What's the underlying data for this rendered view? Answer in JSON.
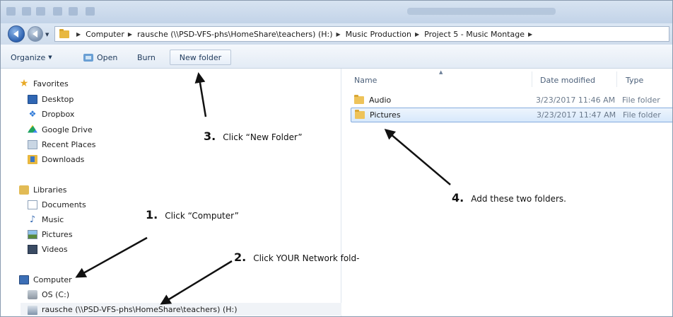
{
  "address_bar": {
    "breadcrumbs": [
      "Computer",
      "rausche (\\\\PSD-VFS-phs\\HomeShare\\teachers) (H:)",
      "Music Production",
      "Project 5 - Music Montage"
    ]
  },
  "toolbar": {
    "organize_label": "Organize",
    "open_label": "Open",
    "burn_label": "Burn",
    "new_folder_label": "New folder"
  },
  "nav": {
    "favorites_label": "Favorites",
    "favorites": [
      "Desktop",
      "Dropbox",
      "Google Drive",
      "Recent Places",
      "Downloads"
    ],
    "libraries_label": "Libraries",
    "libraries": [
      "Documents",
      "Music",
      "Pictures",
      "Videos"
    ],
    "computer_label": "Computer",
    "drives": [
      "OS (C:)",
      "rausche (\\\\PSD-VFS-phs\\HomeShare\\teachers) (H:)"
    ]
  },
  "content": {
    "columns": {
      "name": "Name",
      "date_modified": "Date modified",
      "type": "Type"
    },
    "files": [
      {
        "name": "Audio",
        "date": "3/23/2017 11:46 AM",
        "type": "File folder"
      },
      {
        "name": "Pictures",
        "date": "3/23/2017 11:47 AM",
        "type": "File folder"
      }
    ]
  },
  "annotations": [
    {
      "num": "1.",
      "text": "Click “Computer”"
    },
    {
      "num": "2.",
      "text": "Click YOUR Network fold-"
    },
    {
      "num": "3.",
      "text": "Click “New Folder”"
    },
    {
      "num": "4.",
      "text": "Add these two folders."
    }
  ],
  "colors": {
    "selection": "#d7e8fb",
    "selection_border": "#84acdd",
    "folder": "#eec35a",
    "toolbar_text": "#1e395b"
  }
}
